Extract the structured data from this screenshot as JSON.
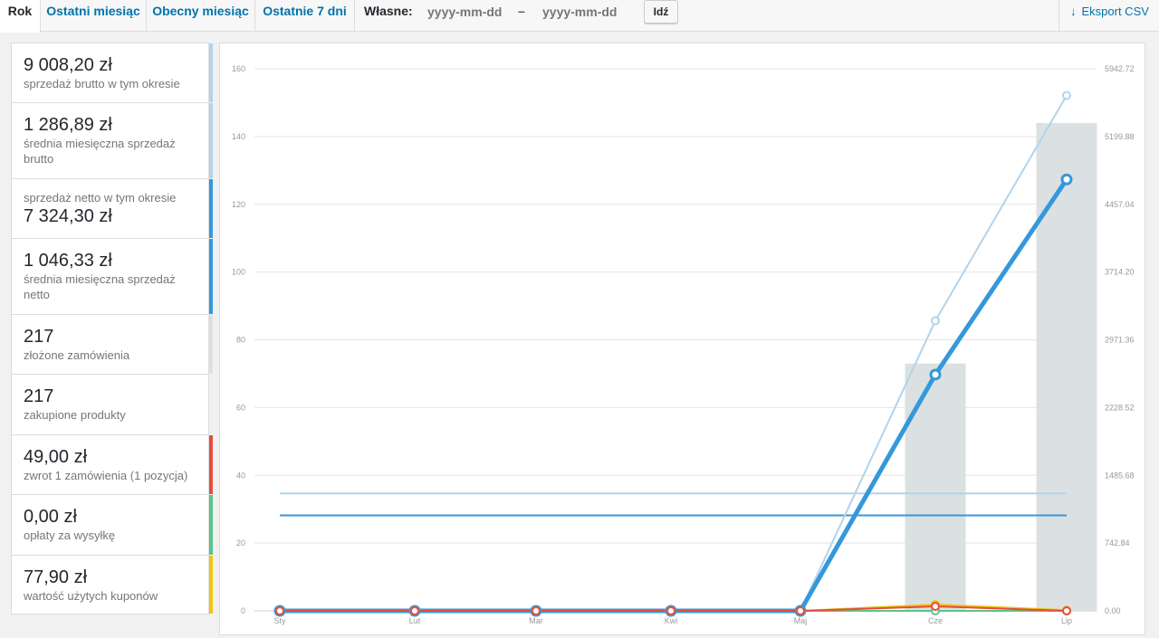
{
  "tabs": [
    {
      "label": "Rok",
      "active": true
    },
    {
      "label": "Ostatni miesiąc",
      "active": false
    },
    {
      "label": "Obecny miesiąc",
      "active": false
    },
    {
      "label": "Ostatnie 7 dni",
      "active": false
    }
  ],
  "custom": {
    "label": "Własne:",
    "from_placeholder": "yyyy-mm-dd",
    "separator": "–",
    "to_placeholder": "yyyy-mm-dd",
    "go_label": "Idź"
  },
  "export": {
    "label": "Eksport CSV",
    "icon": "download-arrow-icon"
  },
  "legend": [
    {
      "value": "9 008,20 zł",
      "label": "sprzedaż brutto w tym okresie",
      "color": "#b1d4ea",
      "value_first": true
    },
    {
      "value": "1 286,89 zł",
      "label": "średnia miesięczna sprzedaż brutto",
      "color": "#b1d4ea",
      "value_first": true
    },
    {
      "value": "7 324,30 zł",
      "label": "sprzedaż netto w tym okresie",
      "color": "#3498db",
      "value_first": false
    },
    {
      "value": "1 046,33 zł",
      "label": "średnia miesięczna sprzedaż netto",
      "color": "#3498db",
      "value_first": true
    },
    {
      "value": "217",
      "label": "złożone zamówienia",
      "color": "#dbe1e3",
      "value_first": true
    },
    {
      "value": "217",
      "label": "zakupione produkty",
      "color": "#ecf0f1",
      "value_first": true
    },
    {
      "value": "49,00 zł",
      "label": "zwrot 1 zamówienia (1 pozycja)",
      "color": "#e74c3c",
      "value_first": true
    },
    {
      "value": "0,00 zł",
      "label": "opłaty za wysyłkę",
      "color": "#5cc488",
      "value_first": true
    },
    {
      "value": "77,90 zł",
      "label": "wartość użytych kuponów",
      "color": "#f1c40f",
      "value_first": true
    }
  ],
  "chart_data": {
    "type": "line",
    "categories": [
      "Sty",
      "Lut",
      "Mar",
      "Kwi",
      "Maj",
      "Cze",
      "Lip"
    ],
    "y_left": {
      "ticks": [
        "0",
        "20",
        "40",
        "60",
        "80",
        "100",
        "120",
        "140",
        "160"
      ],
      "range": [
        0,
        160
      ]
    },
    "y_right": {
      "ticks": [
        "0.00",
        "742.84",
        "1485.68",
        "2228.52",
        "2971.36",
        "3714.20",
        "4457.04",
        "5199.88",
        "5942.72"
      ],
      "range": [
        0,
        5942.72
      ]
    },
    "bars": {
      "axis": "left",
      "color": "#dbe1e3",
      "values": [
        0,
        0,
        0,
        0,
        0,
        73,
        144
      ]
    },
    "series": [
      {
        "axis": "right",
        "color": "#b1d4ea",
        "width": 2,
        "values": [
          0,
          0,
          0,
          0,
          0,
          3180,
          5650
        ]
      },
      {
        "axis": "right",
        "color": "#3498db",
        "width": 5,
        "values": [
          0,
          0,
          0,
          0,
          0,
          2590,
          4730
        ]
      },
      {
        "axis": "right",
        "color": "#5cc488",
        "width": 2,
        "values": [
          0,
          0,
          0,
          0,
          0,
          0,
          0
        ]
      },
      {
        "axis": "right",
        "color": "#f1c40f",
        "width": 2,
        "values": [
          0,
          0,
          0,
          0,
          0,
          70,
          8
        ]
      },
      {
        "axis": "right",
        "color": "#e74c3c",
        "width": 2,
        "values": [
          0,
          0,
          0,
          0,
          0,
          49,
          0
        ]
      }
    ],
    "averages": [
      {
        "axis": "right",
        "color": "#b1d4ea",
        "value": 1286.89
      },
      {
        "axis": "right",
        "color": "#3498db",
        "value": 1046.33
      }
    ],
    "grid": true
  }
}
